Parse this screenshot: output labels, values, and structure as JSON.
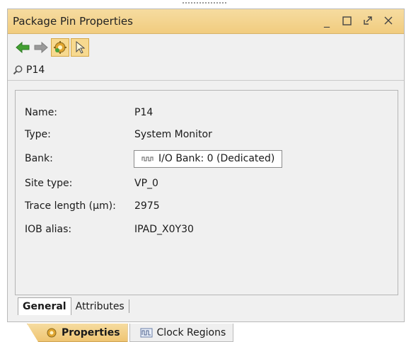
{
  "panel": {
    "title": "Package Pin Properties"
  },
  "window_controls": [
    {
      "name": "minimize-button",
      "glyph": "_"
    },
    {
      "name": "maximize-button",
      "glyph": "☐"
    },
    {
      "name": "float-button",
      "glyph": "⤢"
    },
    {
      "name": "close-button",
      "glyph": "✕"
    }
  ],
  "toolbar": {
    "icons": [
      "back-arrow-icon",
      "forward-arrow-icon",
      "auto-update-gear-icon",
      "select-cursor-icon"
    ]
  },
  "search": {
    "value": "P14"
  },
  "properties": [
    {
      "label": "Name:",
      "value": "P14"
    },
    {
      "label": "Type:",
      "value": "System Monitor"
    },
    {
      "label": "Bank:",
      "value": "I/O Bank: 0 (Dedicated)"
    },
    {
      "label": "Site type:",
      "value": "VP_0"
    },
    {
      "label": "Trace length (µm):",
      "value": "2975"
    },
    {
      "label": "IOB alias:",
      "value": "IPAD_X0Y30"
    }
  ],
  "subtabs": [
    {
      "label": "General",
      "active": true
    },
    {
      "label": "Attributes",
      "active": false
    }
  ],
  "bottom_tabs": [
    {
      "label": "Properties",
      "active": true
    },
    {
      "label": "Clock Regions",
      "active": false
    }
  ],
  "colors": {
    "title_bar": "#f3d18a",
    "panel_bg": "#f0f0f0",
    "arrow_green": "#3f9a2f"
  }
}
